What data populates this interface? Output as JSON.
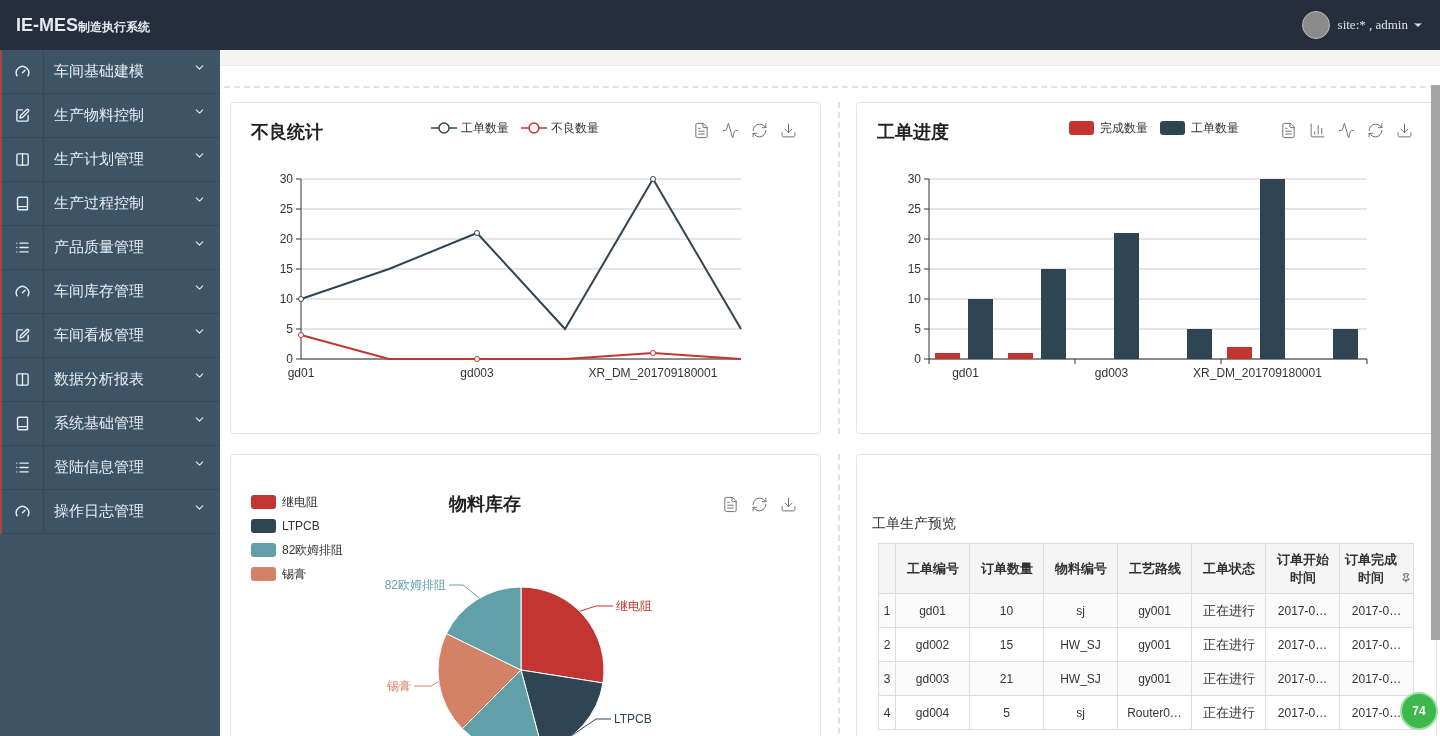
{
  "header": {
    "logo": "IE-MES",
    "logo_subtitle": "制造执行系统",
    "user": "site:* , admin"
  },
  "sidebar": {
    "items": [
      {
        "label": "车间基础建模"
      },
      {
        "label": "生产物料控制"
      },
      {
        "label": "生产计划管理"
      },
      {
        "label": "生产过程控制"
      },
      {
        "label": "产品质量管理"
      },
      {
        "label": "车间库存管理"
      },
      {
        "label": "车间看板管理"
      },
      {
        "label": "数据分析报表"
      },
      {
        "label": "系统基础管理"
      },
      {
        "label": "登陆信息管理"
      },
      {
        "label": "操作日志管理"
      }
    ]
  },
  "defect_panel": {
    "title": "不良统计",
    "chart_data": {
      "type": "line",
      "grid": true,
      "categories": [
        "gd01",
        null,
        "gd003",
        null,
        "XR_DM_201709180001",
        null
      ],
      "ylim": [
        0,
        30
      ],
      "yticks": [
        0,
        5,
        10,
        15,
        20,
        25,
        30
      ],
      "series": [
        {
          "name": "工单数量",
          "color": "#2f4554",
          "values": [
            10,
            15,
            21,
            5,
            30,
            5
          ]
        },
        {
          "name": "不良数量",
          "color": "#c23531",
          "values": [
            4,
            0,
            0,
            0,
            1,
            0
          ]
        }
      ]
    }
  },
  "progress_panel": {
    "title": "工单进度",
    "chart_data": {
      "type": "bar",
      "grid": true,
      "categories": [
        "gd01",
        null,
        "gd003",
        null,
        "XR_DM_201709180001",
        null
      ],
      "ylim": [
        0,
        30
      ],
      "yticks": [
        0,
        5,
        10,
        15,
        20,
        25,
        30
      ],
      "series": [
        {
          "name": "完成数量",
          "color": "#c23531",
          "values": [
            1,
            1,
            0,
            0,
            2,
            0
          ]
        },
        {
          "name": "工单数量",
          "color": "#2f4554",
          "values": [
            10,
            15,
            21,
            5,
            30,
            5
          ]
        }
      ]
    }
  },
  "stock_panel": {
    "title": "物料库存",
    "legend": [
      {
        "label": "继电阻",
        "color": "#c23531"
      },
      {
        "label": "LTPCB",
        "color": "#2f4554"
      },
      {
        "label": "82欧姆排阻",
        "color": "#61a0a8"
      },
      {
        "label": "锡膏",
        "color": "#d48265"
      }
    ],
    "slice_labels": [
      "继电阻",
      "LTPCB",
      "82欧姆排阻",
      "锡膏"
    ]
  },
  "order_panel": {
    "title": "工单生产预览",
    "table": {
      "columns": [
        "工单编号",
        "订单数量",
        "物料编号",
        "工艺路线",
        "工单状态",
        "订单开始时间",
        "订单完成时间"
      ],
      "rows": [
        {
          "index": "1",
          "cells": [
            "gd01",
            "10",
            "sj",
            "gy001",
            "正在进行",
            "2017-0…",
            "2017-0…"
          ]
        },
        {
          "index": "2",
          "cells": [
            "gd002",
            "15",
            "HW_SJ",
            "gy001",
            "正在进行",
            "2017-0…",
            "2017-0…"
          ]
        },
        {
          "index": "3",
          "cells": [
            "gd003",
            "21",
            "HW_SJ",
            "gy001",
            "正在进行",
            "2017-0…",
            "2017-0…"
          ]
        },
        {
          "index": "4",
          "cells": [
            "gd004",
            "5",
            "sj",
            "Router0…",
            "正在进行",
            "2017-0…",
            "2017-0…"
          ]
        }
      ]
    }
  },
  "floating_badge": "74"
}
